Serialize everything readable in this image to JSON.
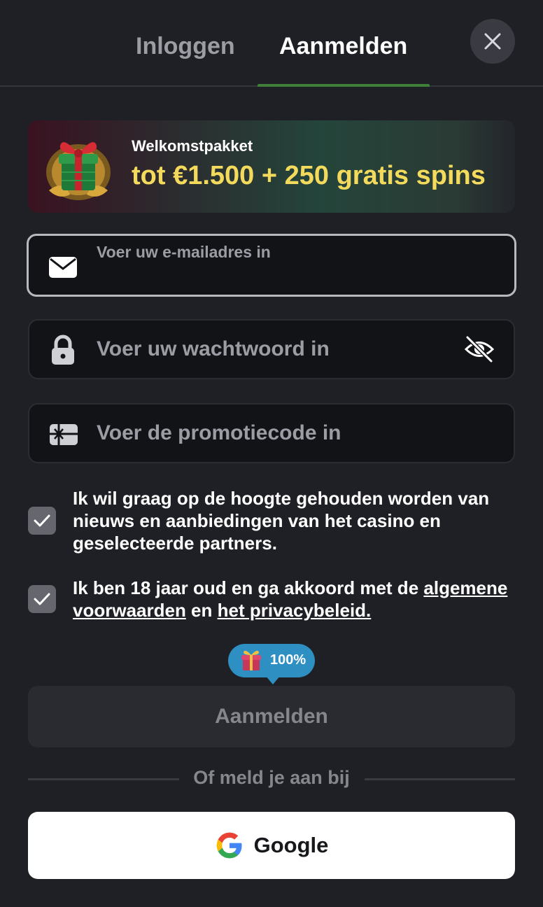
{
  "tabs": {
    "login": "Inloggen",
    "register": "Aanmelden"
  },
  "banner": {
    "label": "Welkomstpakket",
    "amount": "tot €1.500 + 250 gratis spins"
  },
  "email": {
    "label": "Voer uw e-mailadres in",
    "value": ""
  },
  "password": {
    "placeholder": "Voer uw wachtwoord in"
  },
  "promo": {
    "placeholder": "Voer de promotiecode in"
  },
  "consents": {
    "newsletter": "Ik wil graag op de hoogte gehouden worden van nieuws en aanbiedingen van het casino en geselecteerde partners.",
    "age_prefix": "Ik ben 18 jaar oud en ga akkoord met de ",
    "terms_link": "algemene voorwaarden",
    "and": " en ",
    "privacy_link": "het privacybeleid."
  },
  "bonus": {
    "percent": "100%"
  },
  "submit_label": "Aanmelden",
  "divider": "Of meld je aan bij",
  "google_label": "Google",
  "colors": {
    "accent_yellow": "#f3da5c",
    "tab_indicator": "#3f7f3a",
    "bubble": "#2d8fc2"
  },
  "icons": {
    "close": "close-icon",
    "email": "envelope-icon",
    "password": "lock-icon",
    "visibility": "eye-off-icon",
    "promo": "gift-card-icon",
    "check": "checkmark-icon",
    "gift": "gift-icon",
    "google": "google-logo-icon"
  }
}
